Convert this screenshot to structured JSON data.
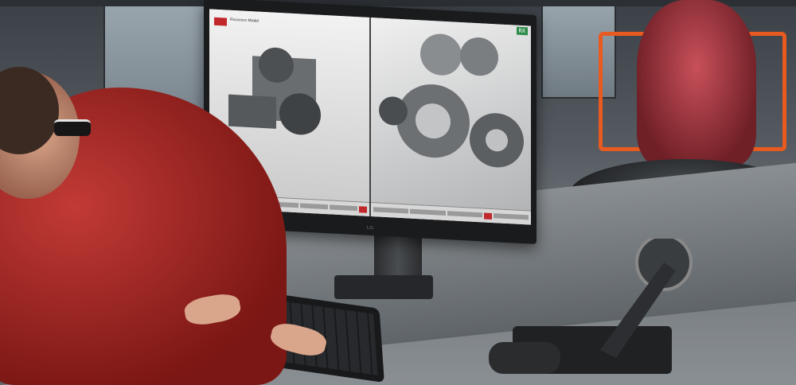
{
  "scene": {
    "monitor": {
      "left_pane_logo_text": "Rxxxxxxx\nModel",
      "status_badge": "RX",
      "brand": "LG"
    }
  }
}
